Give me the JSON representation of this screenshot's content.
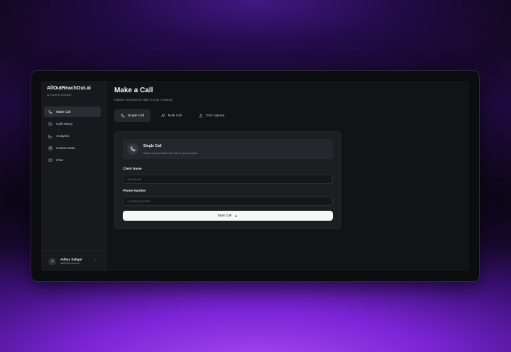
{
  "sidebar": {
    "brand_title": "AllOutReachOut.ai",
    "brand_subtitle": "AI-Powered Outreach",
    "items": [
      {
        "label": "Make Call",
        "icon": "phone-icon",
        "active": true
      },
      {
        "label": "Call History",
        "icon": "history-icon"
      },
      {
        "label": "Analytics",
        "icon": "bar-chart-icon"
      },
      {
        "label": "Custom Data",
        "icon": "database-icon"
      },
      {
        "label": "Chat",
        "icon": "chat-icon"
      }
    ],
    "user": {
      "name": "Aditya Sahgal",
      "email": "adi24@email.com",
      "icon": "user-icon"
    }
  },
  "main": {
    "title": "Make a Call",
    "subtitle": "Initiate AI-powered calls to your contacts",
    "tabs": [
      {
        "label": "Single Call",
        "icon": "phone-icon",
        "active": true
      },
      {
        "label": "Bulk Call",
        "icon": "users-icon"
      },
      {
        "label": "CSV Upload",
        "icon": "upload-icon"
      }
    ],
    "card": {
      "info_title": "Single Call",
      "info_subtitle": "Make a personalized AI call to your contact",
      "client_label": "Client Name",
      "client_placeholder": "John Smith",
      "phone_label": "Phone Number",
      "phone_placeholder": "+1 (555) 123-4567",
      "start_label": "Start Call"
    }
  },
  "colors": {
    "accent_purple": "#7a22d6",
    "panel": "#111317",
    "button": "#f7f7f8"
  }
}
